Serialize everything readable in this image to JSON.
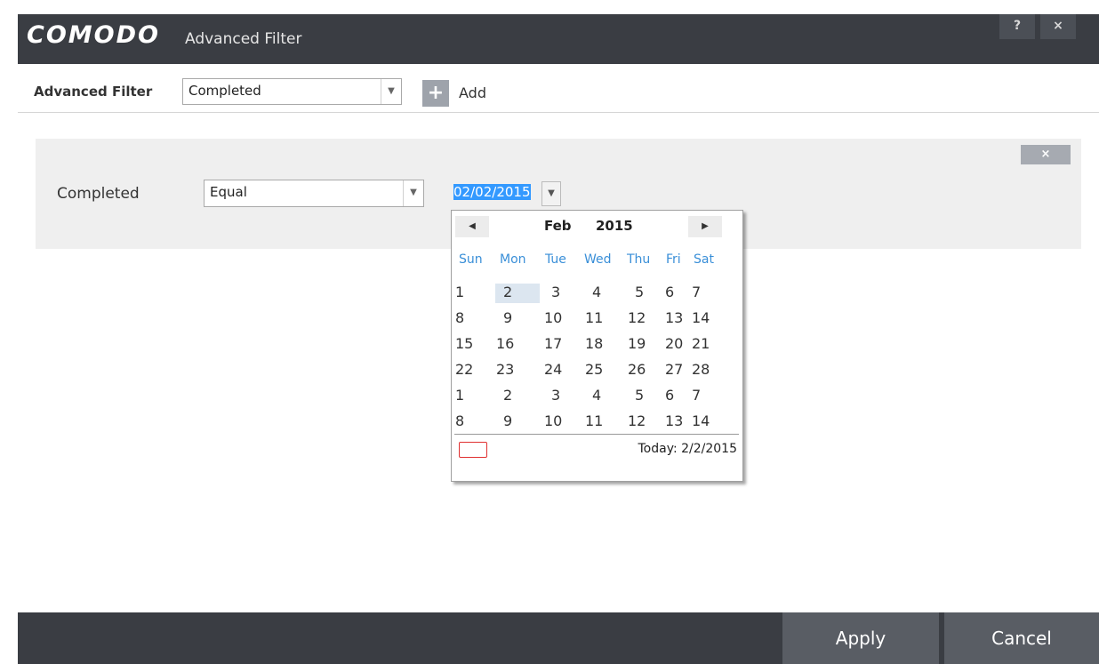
{
  "window": {
    "logo": "COMODO",
    "title": "Advanced Filter",
    "help": "?",
    "close": "×"
  },
  "toolbar": {
    "label": "Advanced Filter",
    "filter_value": "Completed",
    "add_label": "Add"
  },
  "condition": {
    "field_label": "Completed",
    "operator_value": "Equal",
    "date": {
      "month": "02",
      "day": "02",
      "year": "2015",
      "sep": "/"
    },
    "remove": "×"
  },
  "calendar": {
    "month": "Feb",
    "year": "2015",
    "weekdays": [
      "Sun",
      "Mon",
      "Tue",
      "Wed",
      "Thu",
      "Fri",
      "Sat"
    ],
    "weeks": [
      [
        "1",
        "2",
        "3",
        "4",
        "5",
        "6",
        "7"
      ],
      [
        "8",
        "9",
        "10",
        "11",
        "12",
        "13",
        "14"
      ],
      [
        "15",
        "16",
        "17",
        "18",
        "19",
        "20",
        "21"
      ],
      [
        "22",
        "23",
        "24",
        "25",
        "26",
        "27",
        "28"
      ],
      [
        "1",
        "2",
        "3",
        "4",
        "5",
        "6",
        "7"
      ],
      [
        "8",
        "9",
        "10",
        "11",
        "12",
        "13",
        "14"
      ]
    ],
    "today_label": "Today: 2/2/2015"
  },
  "footer": {
    "apply": "Apply",
    "cancel": "Cancel"
  },
  "colors": {
    "titlebar": "#3a3d43",
    "panel": "#efefef",
    "accent_blue": "#3399ff",
    "weekday_blue": "#3a8fd8"
  }
}
